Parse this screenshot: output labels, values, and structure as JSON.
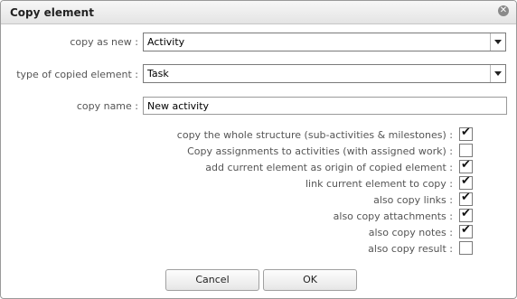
{
  "dialog": {
    "title": "Copy element",
    "close_icon": "close-icon"
  },
  "fields": {
    "copy_as_new": {
      "label": "copy as new :",
      "value": "Activity"
    },
    "type_of_copied": {
      "label": "type of copied element :",
      "value": "Task"
    },
    "copy_name": {
      "label": "copy name :",
      "value": "New activity"
    }
  },
  "options": [
    {
      "label": "copy the whole structure (sub-activities & milestones) :",
      "checked": true
    },
    {
      "label": "Copy assignments to activities (with assigned work) :",
      "checked": false
    },
    {
      "label": "add current element as origin of copied element :",
      "checked": true
    },
    {
      "label": "link current element to copy :",
      "checked": true
    },
    {
      "label": "also copy links :",
      "checked": true
    },
    {
      "label": "also copy attachments :",
      "checked": true
    },
    {
      "label": "also copy notes :",
      "checked": true
    },
    {
      "label": "also copy result :",
      "checked": false
    }
  ],
  "buttons": {
    "cancel": "Cancel",
    "ok": "OK"
  }
}
